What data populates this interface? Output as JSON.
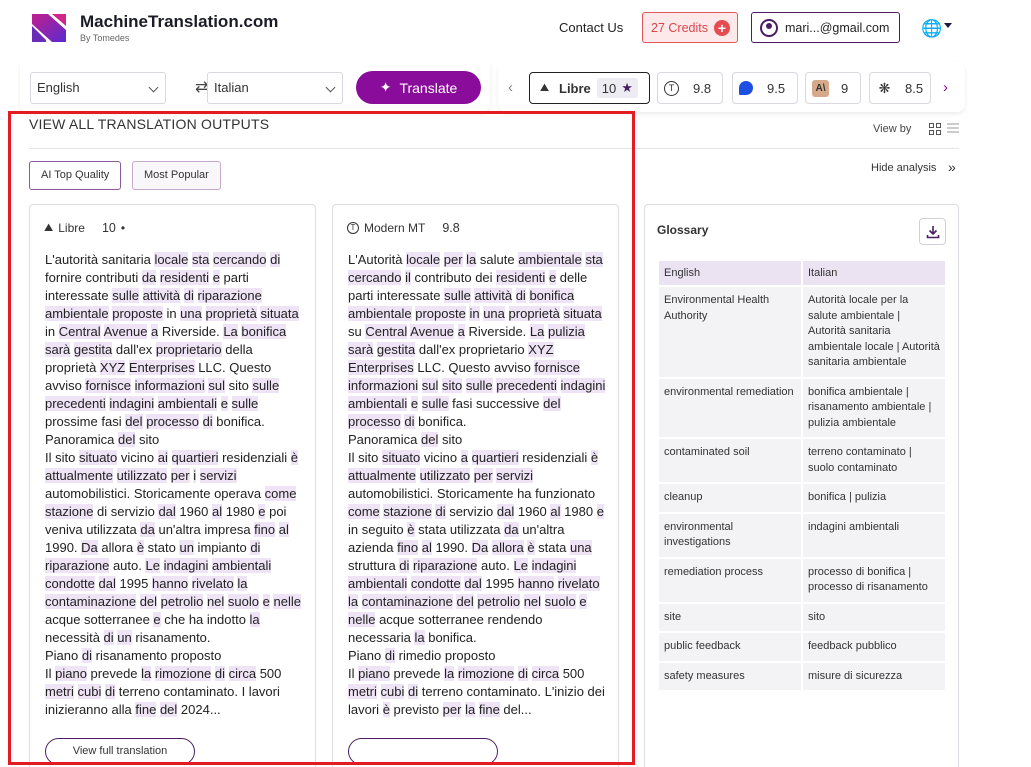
{
  "header": {
    "brand_name": "MachineTranslation.com",
    "brand_sub": "By Tomedes",
    "contact": "Contact Us",
    "credits": "27 Credits",
    "account_email": "mari...@gmail.com"
  },
  "toolbar": {
    "source_lang": "English",
    "target_lang": "Italian",
    "translate_label": "Translate",
    "engines": [
      {
        "name": "Libre",
        "score": "10",
        "icon": "libre-icon",
        "active": true
      },
      {
        "name": "",
        "score": "9.8",
        "icon": "modernmt-icon"
      },
      {
        "name": "",
        "score": "9.5",
        "icon": "deepl-icon"
      },
      {
        "name": "",
        "score": "9",
        "icon": "anthropic-icon"
      },
      {
        "name": "",
        "score": "8.5",
        "icon": "openai-icon"
      }
    ]
  },
  "main": {
    "section_title": "VIEW ALL TRANSLATION OUTPUTS",
    "view_by": "View by",
    "filters": [
      "AI Top Quality",
      "Most Popular"
    ],
    "hide_analysis": "Hide analysis",
    "view_full_label": "View full translation"
  },
  "cards": [
    {
      "engine": "Libre",
      "score": "10",
      "dot": "•"
    },
    {
      "engine": "Modern MT",
      "score": "9.8"
    }
  ],
  "glossary": {
    "title": "Glossary",
    "head": [
      "English",
      "Italian"
    ],
    "rows": [
      [
        "Environmental Health Authority",
        "Autorità locale per la salute ambientale | Autorità sanitaria ambientale locale | Autorità sanitaria ambientale"
      ],
      [
        "environmental remediation",
        "bonifica ambientale | risanamento ambientale | pulizia ambientale"
      ],
      [
        "contaminated soil",
        "terreno contaminato | suolo contaminato"
      ],
      [
        "cleanup",
        "bonifica | pulizia"
      ],
      [
        "environmental investigations",
        "indagini ambientali"
      ],
      [
        "remediation process",
        "processo di bonifica | processo di risanamento"
      ],
      [
        "site",
        "sito"
      ],
      [
        "public feedback",
        "feedback pubblico"
      ],
      [
        "safety measures",
        "misure di sicurezza"
      ]
    ]
  },
  "texts": {
    "libre": "L'autorità sanitaria [locale] [sta] [cercando] [di] fornire contributi [da] [residenti] [e] parti interessate [sulle] [attività] [di] [riparazione] [ambientale] [proposte] in [una] [proprietà] [situata] in [Central] [Avenue] [a] Riverside. [La] [bonifica] [sarà] [gestita] dall'ex [proprietario] della proprietà [XYZ] [Enterprises] LLC. Questo avviso [fornisce] [informazioni] [sul] sito [sulle] [precedenti] [indagini] [ambientali] [e] [sulle] prossime fasi [del] [processo] [di] bonifica.\nPanoramica [del] sito\nIl sito [situato] vicino [ai] [quartieri] residenziali [è] [attualmente] [utilizzato] [per] [i] [servizi] automobilistici. Storicamente operava [come] [stazione] di servizio [dal] 1960 [al] 1980 [e] poi veniva utilizzata [da] un'altra impresa [fino] [al] 1990. [Da] allora [è] stato [un] impianto [di] [riparazione] auto. [Le] [indagini] [ambientali] [condotte] [dal] 1995 [hanno] [rivelato] [la] [contaminazione] [del] [petrolio] [nel] [suolo] [e] [nelle] acque sotterranee [e] che ha indotto [la] necessità [di] [un] risanamento.\nPiano [di] risanamento proposto\nIl [piano] prevede [la] [rimozione] [di] [circa] 500 [metri] [cubi] [di] terreno contaminato. I lavori inizieranno alla [fine] [del] 2024...",
    "modern": "L'Autorità [locale] [per] [la] salute [ambientale] [sta] [cercando] [il] contributo dei [residenti] [e] delle parti interessate [sulle] [attività] [di] [bonifica] [ambientale] [proposte] [in] [una] [proprietà] [situata] su [Central] [Avenue] [a] Riverside. [La] [pulizia] [sarà] [gestita] dall'ex proprietario [XYZ] [Enterprises] LLC. Questo avviso [fornisce] [informazioni] [sul] [sito] [sulle] [precedenti] [indagini] [ambientali] [e] [sulle] fasi successive [del] [processo] [di] bonifica.\nPanoramica [del] sito\nIl sito [situato] vicino [a] [quartieri] residenziali [è] [attualmente] [utilizzato] [per] [servizi] automobilistici. Storicamente ha funzionato [come] [stazione] [di] servizio [dal] 1960 [al] 1980 [e] in seguito [è] stata utilizzata [da] un'altra azienda [fino] [al] 1990. [Da] [allora] [è] stata [una] struttura [di] [riparazione] auto. [Le] [indagini] [ambientali] [condotte] [dal] 1995 [hanno] [rivelato] [la] [contaminazione] [del] [petrolio] [nel] [suolo] [e] [nelle] acque sotterranee rendendo necessaria [la] bonifica.\nPiano [di] rimedio proposto\nIl [piano] prevede [la] [rimozione] [di] [circa] 500 [metri] [cubi] [di] terreno contaminato. L'inizio dei lavori [è] previsto [per] [la] [fine] del..."
  },
  "colors": {
    "accent": "#8a0c9a",
    "highlight": "#efe4f6",
    "frame": "#e31b23",
    "credits": "#d9474e"
  }
}
